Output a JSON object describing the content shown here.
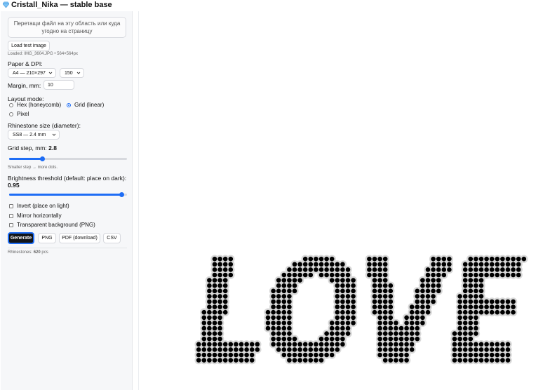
{
  "app": {
    "title": "Cristall_Nika — stable base",
    "icon": "gem-icon"
  },
  "sidebar": {
    "dropzone_text": "Перетащи файл на эту область или куда угодно на страницу",
    "load_test_label": "Load test image",
    "loaded_info": "Loaded: IMG_3604.JPG • 564×564px",
    "paper_dpi_label": "Paper & DPI:",
    "paper_value": "A4 — 210×297",
    "dpi_value": "150",
    "margin_label": "Margin, mm:",
    "margin_value": "10",
    "layout_mode_label": "Layout mode:",
    "layout_options": [
      {
        "label": "Hex (honeycomb)",
        "selected": false
      },
      {
        "label": "Grid (linear)",
        "selected": true
      },
      {
        "label": "Pixel",
        "selected": false
      }
    ],
    "rhinestone_label": "Rhinestone size (diameter):",
    "rhinestone_value": "SS8 — 2.4 mm",
    "grid_step_label": "Grid step, mm:",
    "grid_step_value": "2.8",
    "grid_step_slider_fraction": 0.28,
    "grid_step_hint": "Smaller step → more dots.",
    "brightness_label": "Brightness threshold (default: place on dark):",
    "brightness_value": "0.95",
    "brightness_slider_fraction": 0.95,
    "invert_label": "Invert (place on light)",
    "mirror_label": "Mirror horizontally",
    "transparent_label": "Transparent background (PNG)",
    "invert_checked": false,
    "mirror_checked": false,
    "transparent_checked": false,
    "generate_label": "Generate",
    "png_label": "PNG",
    "pdf_label": "PDF (download)",
    "csv_label": "CSV",
    "count_prefix": "Rhinestones:",
    "count_value": "620",
    "count_suffix": "pcs"
  },
  "colors": {
    "accent": "#1e6df5",
    "dot": "#000000",
    "halo": "#d8d8d8"
  },
  "preview": {
    "text": "LOVE"
  }
}
